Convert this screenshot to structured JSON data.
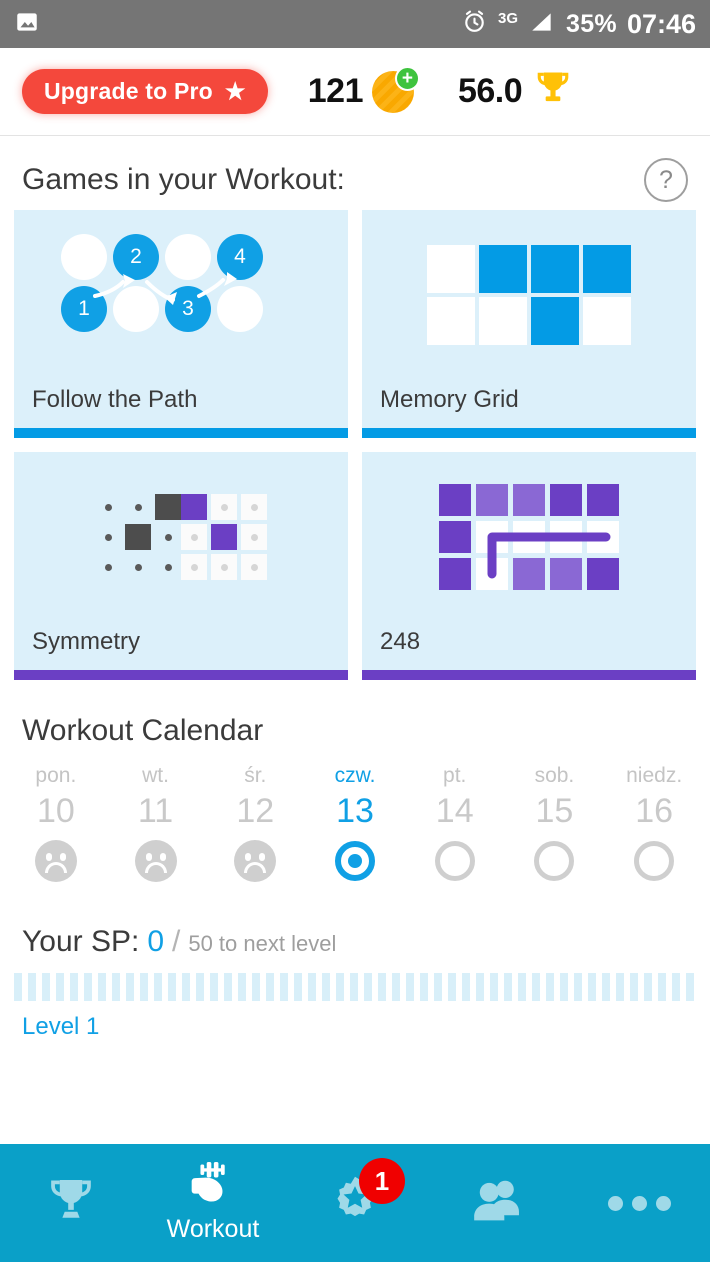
{
  "status_bar": {
    "left_icon": "image-icon",
    "alarm_icon": "alarm-clock-icon",
    "network": "3G",
    "signal_icon": "signal-bars-icon",
    "battery": "35%",
    "time": "07:46"
  },
  "header": {
    "upgrade_label": "Upgrade to Pro",
    "upgrade_star_icon": "star-icon",
    "coins": "121",
    "coin_icon": "coin-icon",
    "coin_plus_icon": "plus-icon",
    "score": "56.0",
    "trophy_icon": "trophy-icon"
  },
  "games": {
    "title": "Games in your Workout:",
    "help_icon": "question-mark-icon",
    "help_label": "?",
    "cards": [
      {
        "label": "Follow the Path",
        "accent": "#039be5",
        "art": "path-nodes"
      },
      {
        "label": "Memory Grid",
        "accent": "#039be5",
        "art": "memory-grid"
      },
      {
        "label": "Symmetry",
        "accent": "#6b3fc4",
        "art": "symmetry-grid"
      },
      {
        "label": "248",
        "accent": "#6b3fc4",
        "art": "tile-path-grid"
      }
    ],
    "path_nodes": [
      {
        "label": "",
        "active": false
      },
      {
        "label": "2",
        "active": true
      },
      {
        "label": "",
        "active": false
      },
      {
        "label": "4",
        "active": true
      },
      {
        "label": "1",
        "active": true
      },
      {
        "label": "",
        "active": false
      },
      {
        "label": "3",
        "active": true
      },
      {
        "label": "",
        "active": false
      }
    ],
    "memory_grid": [
      [
        0,
        1,
        1,
        1
      ],
      [
        0,
        0,
        1,
        0
      ]
    ],
    "symmetry_left": [
      "dot",
      "dot",
      "dark",
      "dot",
      "dark",
      "dot",
      "dot",
      "dot",
      "dot"
    ],
    "symmetry_right": [
      "purple",
      "tile",
      "tile",
      "tile",
      "purple",
      "tile",
      "tile",
      "tile",
      "tile"
    ],
    "tiles_248": [
      [
        "dark",
        "light",
        "light",
        "dark",
        "dark"
      ],
      [
        "dark",
        "white",
        "white",
        "white",
        "white"
      ],
      [
        "dark",
        "white",
        "light",
        "light",
        "dark"
      ]
    ]
  },
  "calendar": {
    "title": "Workout Calendar",
    "days": [
      {
        "dow": "pon.",
        "num": "10",
        "state": "missed",
        "today": false
      },
      {
        "dow": "wt.",
        "num": "11",
        "state": "missed",
        "today": false
      },
      {
        "dow": "śr.",
        "num": "12",
        "state": "missed",
        "today": false
      },
      {
        "dow": "czw.",
        "num": "13",
        "state": "today",
        "today": true
      },
      {
        "dow": "pt.",
        "num": "14",
        "state": "upcoming",
        "today": false
      },
      {
        "dow": "sob.",
        "num": "15",
        "state": "upcoming",
        "today": false
      },
      {
        "dow": "niedz.",
        "num": "16",
        "state": "upcoming",
        "today": false
      }
    ]
  },
  "sp": {
    "label": "Your SP:",
    "value": "0",
    "separator": "/",
    "next_level_text": "50 to next level",
    "level": "Level 1",
    "progress_percent": 0
  },
  "nav": {
    "items": [
      {
        "icon": "trophy-icon",
        "label": "",
        "badge": ""
      },
      {
        "icon": "muscle-dumbbell-icon",
        "label": "Workout",
        "badge": ""
      },
      {
        "icon": "gear-star-icon",
        "label": "",
        "badge": "1"
      },
      {
        "icon": "people-icon",
        "label": "",
        "badge": ""
      },
      {
        "icon": "more-dots-icon",
        "label": "",
        "badge": ""
      }
    ]
  },
  "colors": {
    "status_bar": "#757575",
    "accent_blue": "#039be5",
    "accent_purple": "#6b3fc4",
    "nav_bar": "#0aa0c8",
    "upgrade_red": "#f4483c",
    "badge_red": "#f00000",
    "card_bg": "#dcf0fa"
  }
}
